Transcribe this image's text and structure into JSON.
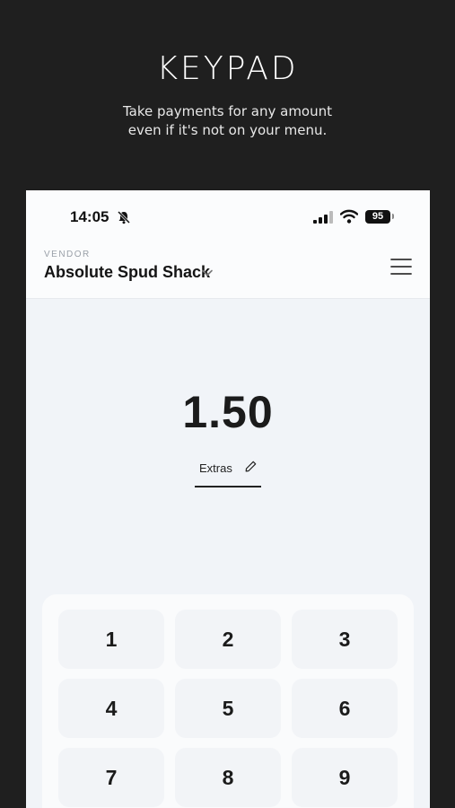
{
  "promo": {
    "title": "KEYPAD",
    "subtitle_line1": "Take payments for any amount",
    "subtitle_line2": "even if it's not on your  menu."
  },
  "status_bar": {
    "time": "14:05",
    "battery": "95"
  },
  "header": {
    "vendor_label": "VENDOR",
    "vendor_name": "Absolute Spud Shack"
  },
  "amount": "1.50",
  "note": {
    "label": "Extras"
  },
  "keypad": {
    "keys": [
      "1",
      "2",
      "3",
      "4",
      "5",
      "6",
      "7",
      "8",
      "9"
    ]
  }
}
